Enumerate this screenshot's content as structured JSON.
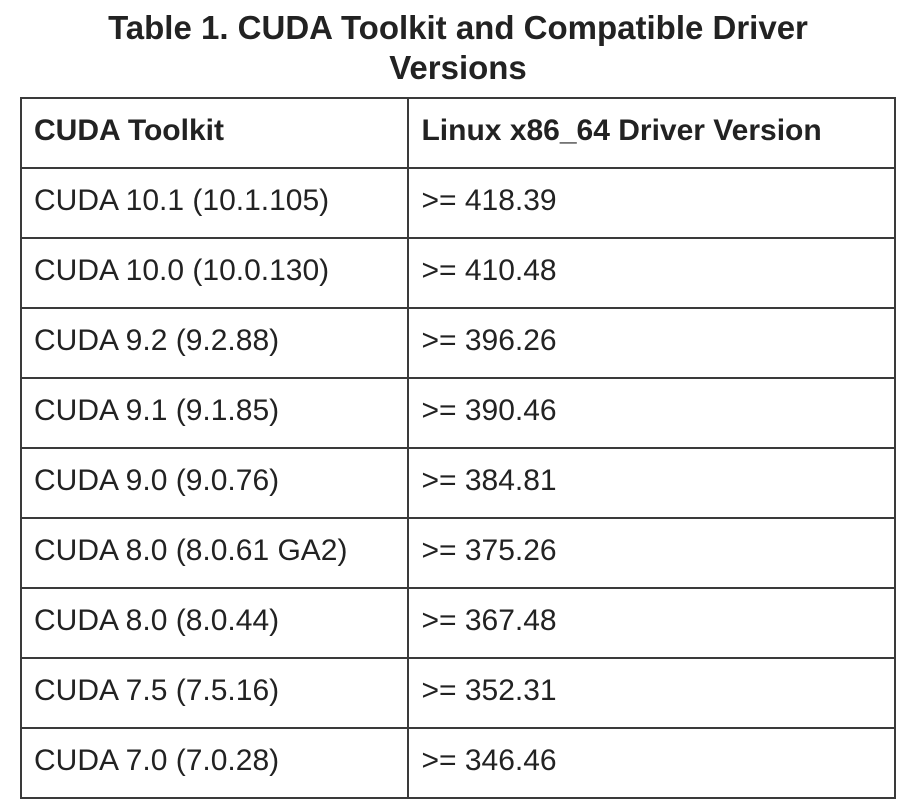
{
  "chart_data": {
    "type": "table",
    "title": "Table 1. CUDA Toolkit and Compatible Driver Versions",
    "columns": [
      "CUDA Toolkit",
      "Linux x86_64 Driver Version"
    ],
    "rows": [
      [
        "CUDA 10.1 (10.1.105)",
        ">= 418.39"
      ],
      [
        "CUDA 10.0 (10.0.130)",
        ">= 410.48"
      ],
      [
        "CUDA 9.2 (9.2.88)",
        ">= 396.26"
      ],
      [
        "CUDA 9.1 (9.1.85)",
        ">= 390.46"
      ],
      [
        "CUDA 9.0 (9.0.76)",
        ">= 384.81"
      ],
      [
        "CUDA 8.0 (8.0.61 GA2)",
        ">= 375.26"
      ],
      [
        "CUDA 8.0 (8.0.44)",
        ">= 367.48"
      ],
      [
        "CUDA 7.5 (7.5.16)",
        ">= 352.31"
      ],
      [
        "CUDA 7.0 (7.0.28)",
        ">= 346.46"
      ]
    ]
  }
}
